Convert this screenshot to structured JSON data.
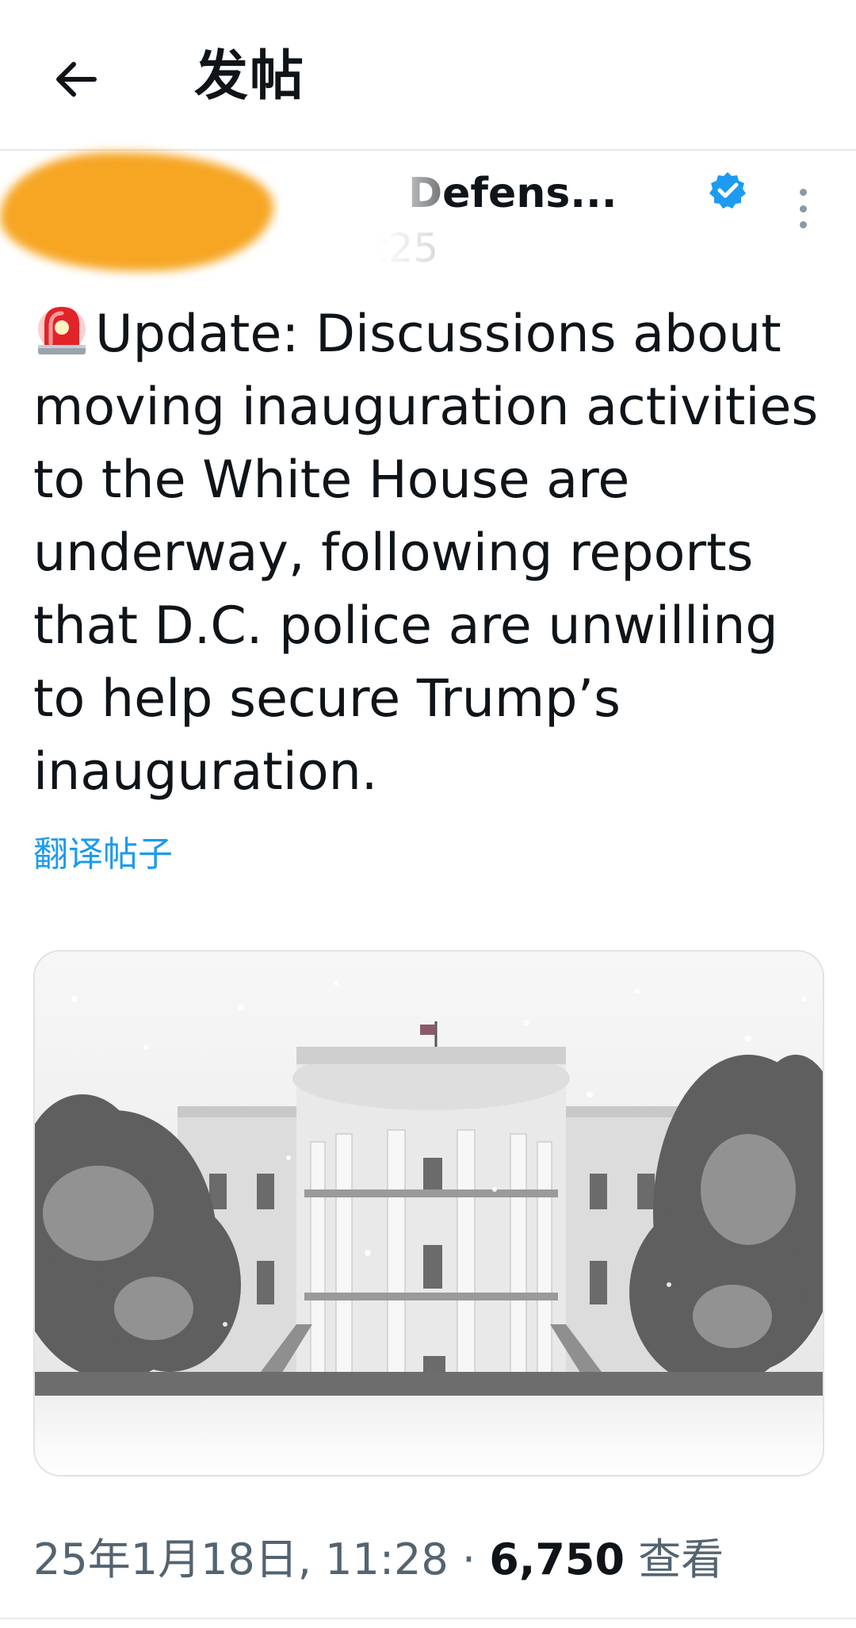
{
  "header": {
    "title": "发帖",
    "back_icon": "arrow-left-icon"
  },
  "author": {
    "display_name": "Defens...",
    "handle": "t25",
    "verified_color": "#1d9bf0",
    "avatar_color": "#f6a623"
  },
  "post": {
    "emoji": "siren-icon",
    "text_lines": [
      "Update: Discussions about",
      "moving inauguration activities",
      "to the White House are",
      "underway, following reports",
      "that D.C. police are unwilling",
      "to help secure Trump’s",
      "inauguration."
    ],
    "translate_label": "翻译帖子"
  },
  "meta": {
    "date_time": "25年1月18日, 11:28",
    "separator": "·",
    "views_count": "6,750",
    "views_label": "查看"
  },
  "colors": {
    "accent": "#1d9bf0",
    "text": "#0f1419",
    "secondary": "#536471"
  }
}
